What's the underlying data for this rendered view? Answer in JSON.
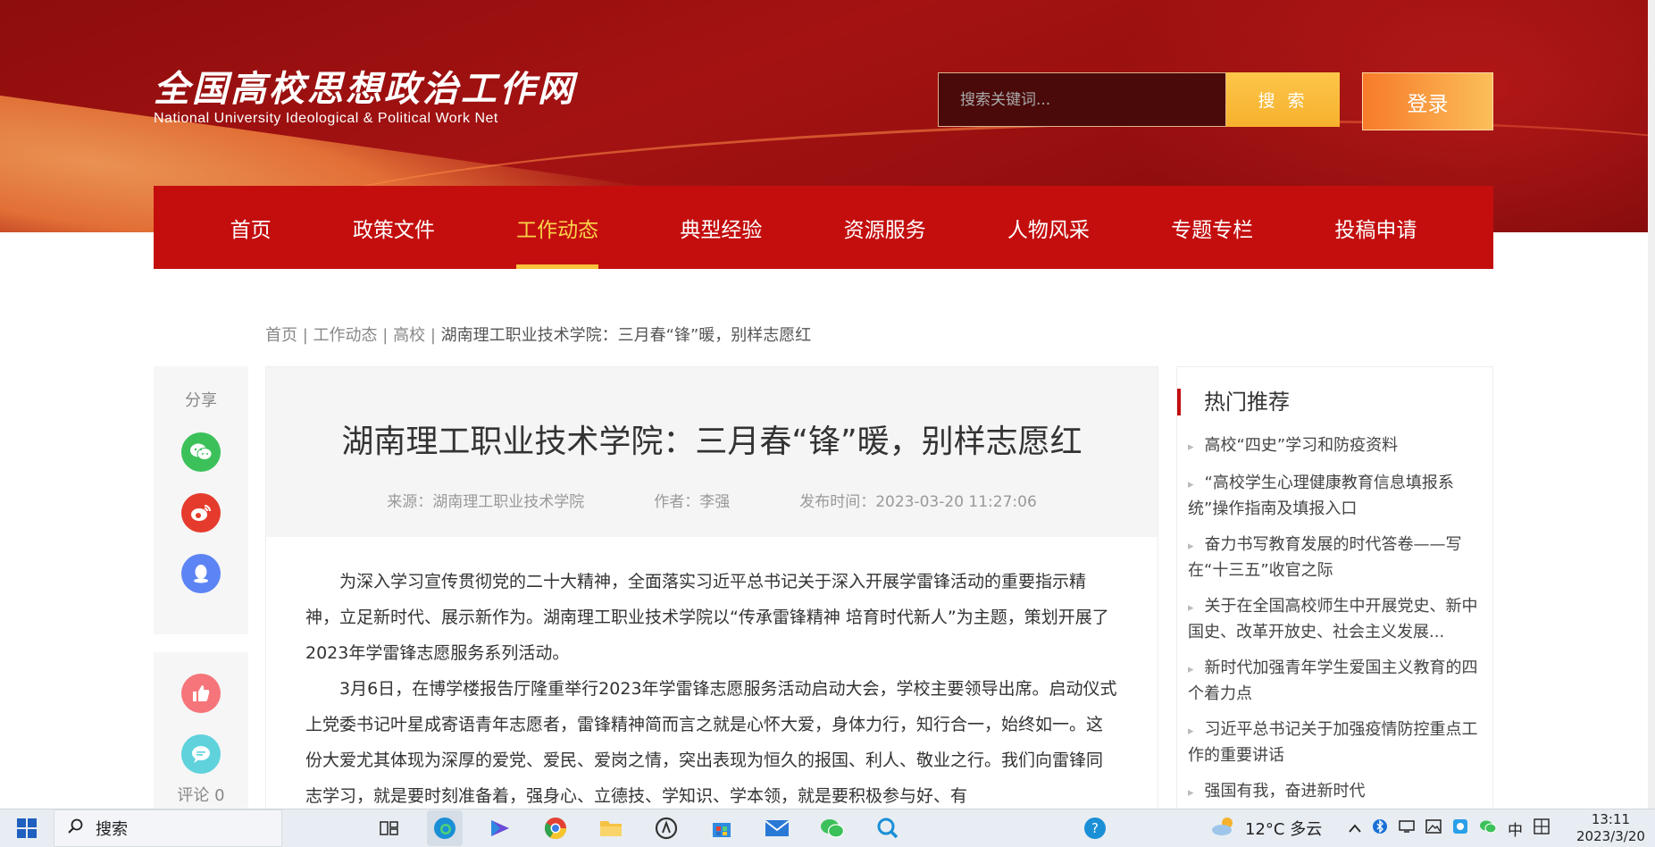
{
  "site": {
    "title_cn": "全国高校思想政治工作网",
    "title_en": "National University Ideological & Political Work Net"
  },
  "header": {
    "search_placeholder": "搜索关键词...",
    "search_button": "搜 索",
    "login_button": "登录"
  },
  "nav": {
    "items": [
      {
        "label": "首页"
      },
      {
        "label": "政策文件"
      },
      {
        "label": "工作动态"
      },
      {
        "label": "典型经验"
      },
      {
        "label": "资源服务"
      },
      {
        "label": "人物风采"
      },
      {
        "label": "专题专栏"
      },
      {
        "label": "投稿申请"
      }
    ],
    "active": "工作动态"
  },
  "breadcrumb": {
    "home": "首页",
    "sep": "|",
    "section": "工作动态",
    "sub": "高校",
    "current": "湖南理工职业技术学院：三月春“锋”暖，别样志愿红"
  },
  "share": {
    "label": "分享",
    "icons": [
      "wechat-icon",
      "weibo-icon",
      "qq-icon"
    ]
  },
  "actions": {
    "comment_label": "评论 0"
  },
  "article": {
    "title": "湖南理工职业技术学院：三月春“锋”暖，别样志愿红",
    "source": "来源：湖南理工职业技术学院",
    "author": "作者：李强",
    "published": "发布时间：2023-03-20 11:27:06",
    "paragraphs": [
      "为深入学习宣传贯彻党的二十大精神，全面落实习近平总书记关于深入开展学雷锋活动的重要指示精神，立足新时代、展示新作为。湖南理工职业技术学院以“传承雷锋精神 培育时代新人”为主题，策划开展了2023年学雷锋志愿服务系列活动。",
      "3月6日，在博学楼报告厅隆重举行2023年学雷锋志愿服务活动启动大会，学校主要领导出席。启动仪式上党委书记叶星成寄语青年志愿者，雷锋精神简而言之就是心怀大爱，身体力行，知行合一，始终如一。这份大爱尤其体现为深厚的爱党、爱民、爱岗之情，突出表现为恒久的报国、利人、敬业之行。我们向雷锋同志学习，就是要时刻准备着，强身心、立德技、学知识、学本领，就是要积极参与好、有"
    ]
  },
  "sidebar": {
    "heading": "热门推荐",
    "items": [
      "高校“四史”学习和防疫资料",
      "“高校学生心理健康教育信息填报系统”操作指南及填报入口",
      "奋力书写教育发展的时代答卷——写在“十三五”收官之际",
      "关于在全国高校师生中开展党史、新中国史、改革开放史、社会主义发展...",
      "新时代加强青年学生爱国主义教育的四个着力点",
      "习近平总书记关于加强疫情防控重点工作的重要讲话",
      "强国有我，奋进新时代"
    ]
  },
  "taskbar": {
    "search_label": "搜索",
    "weather": "12°C 多云",
    "ime": "中",
    "time": "13:11",
    "date": "2023/3/20"
  },
  "colors": {
    "nav_red": "#c40e0e",
    "active_yellow": "#f9d44a",
    "search_yellow": "#f6b12d",
    "login_orange": "#f77a2a"
  }
}
